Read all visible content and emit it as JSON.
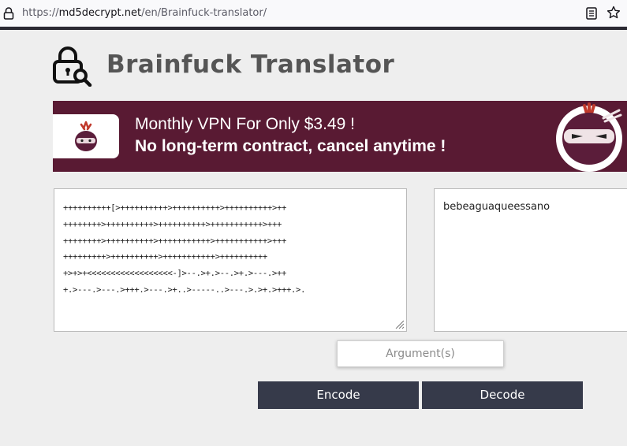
{
  "browser": {
    "url_prefix": "https://",
    "url_domain": "md5decrypt.net",
    "url_path": "/en/Brainfuck-translator/"
  },
  "page": {
    "title": "Brainfuck Translator"
  },
  "banner": {
    "line1": "Monthly VPN For Only $3.49 !",
    "line2": "No long-term contract, cancel anytime !",
    "bg_color": "#591a33"
  },
  "translator": {
    "input_text": "++++++++++[>++++++++++>++++++++++>++++++++++>++\n++++++++>++++++++++>++++++++++>+++++++++++>+++\n++++++++>++++++++++>+++++++++++>+++++++++++>+++\n+++++++++>++++++++++>+++++++++++>++++++++++\n+>+>+<<<<<<<<<<<<<<<<<<-]>--.>+.>--.>+.>---.>++\n+.>---.>---.>+++.>---.>+..>-----..>---.>.>+.>+++.>.",
    "output_text": "bebeaguaqueessano",
    "argument_placeholder": "Argument(s)",
    "encode_label": "Encode",
    "decode_label": "Decode",
    "button_color": "#363a4a"
  }
}
